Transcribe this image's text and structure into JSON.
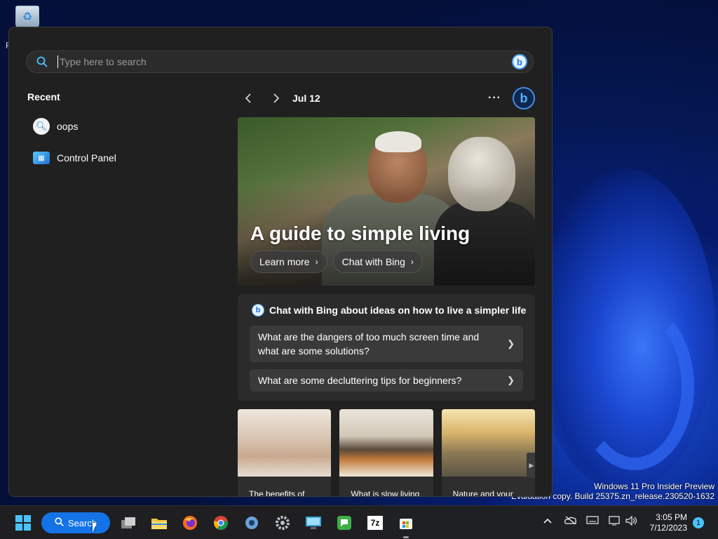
{
  "desktop": {
    "recycle_bin_letter": "R",
    "watermark_line1": "Windows 11 Pro Insider Preview",
    "watermark_line2": "Evaluation copy. Build 25375.zn_release.230520-1632"
  },
  "search": {
    "placeholder": "Type here to search",
    "value": ""
  },
  "recent": {
    "title": "Recent",
    "items": [
      {
        "label": "oops",
        "icon": "search-icon"
      },
      {
        "label": "Control Panel",
        "icon": "control-panel-icon"
      }
    ]
  },
  "highlights": {
    "date": "Jul 12",
    "more_label": "···",
    "hero": {
      "title": "A guide to simple living",
      "learn_more": "Learn more",
      "chat_with_bing": "Chat with Bing"
    },
    "chat_card": {
      "header": "Chat with Bing about ideas on how to live a simpler life",
      "questions": [
        "What are the dangers of too much screen time and what are some solutions?",
        "What are some decluttering tips for beginners?"
      ]
    },
    "tiles": [
      {
        "caption": "The benefits of"
      },
      {
        "caption": "What is slow living"
      },
      {
        "caption": "Nature and your"
      }
    ]
  },
  "taskbar": {
    "search_label": "Search",
    "apps": [
      "task-view",
      "file-explorer",
      "firefox",
      "chrome",
      "settings-alt",
      "settings",
      "remote-desktop",
      "libreoffice",
      "7zip",
      "microsoft-store"
    ],
    "seven_zip_label": "7z",
    "time": "3:05 PM",
    "date": "7/12/2023",
    "notification_count": "1"
  },
  "colors": {
    "accent": "#4cc2ff",
    "taskbar_search": "#1473e6",
    "panel_bg": "#202020"
  }
}
